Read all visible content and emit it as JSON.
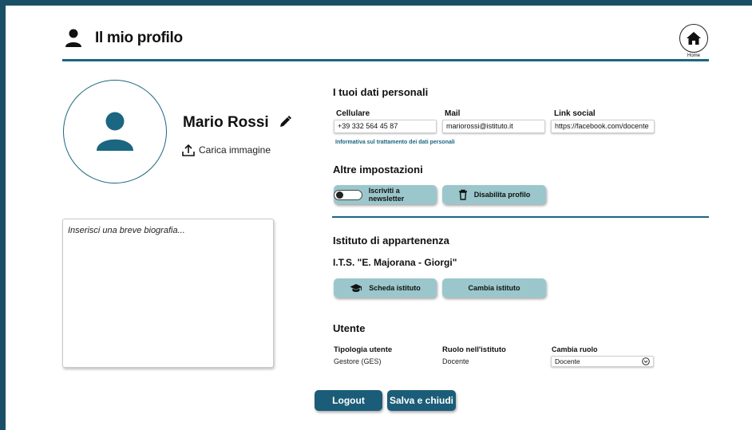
{
  "header": {
    "title": "Il mio profilo",
    "home_label": "Home"
  },
  "profile": {
    "name": "Mario Rossi",
    "upload_label": "Carica immagine",
    "bio_placeholder": "Inserisci una breve biografia..."
  },
  "personal": {
    "title": "I tuoi dati personali",
    "fields": [
      {
        "label": "Cellulare",
        "value": "+39 332 564 45 87"
      },
      {
        "label": "Mail",
        "value": "mariorossi@istituto.it"
      },
      {
        "label": "Link social",
        "value": "https://facebook.com/docente"
      }
    ],
    "privacy_link": "Informativa sul trattamento dei dati personali"
  },
  "settings": {
    "title": "Altre impostazioni",
    "newsletter_label": "Iscriviti a newsletter",
    "newsletter_on": false,
    "disable_label": "Disabilita profilo"
  },
  "institute": {
    "title": "Istituto di appartenenza",
    "name": "I.T.S. \"E. Majorana - Giorgi\"",
    "card_label": "Scheda istituto",
    "change_label": "Cambia istituto"
  },
  "user": {
    "title": "Utente",
    "type_label": "Tipologia utente",
    "type_value": "Gestore (GES)",
    "role_label": "Ruolo nell'istituto",
    "role_value": "Docente",
    "change_role_label": "Cambia ruolo",
    "change_role_value": "Docente"
  },
  "actions": {
    "logout": "Logout",
    "save_close": "Salva e chiudi"
  },
  "colors": {
    "frame": "#1b4f68",
    "accent": "#1b6680",
    "button_light": "#9bc7cc",
    "button_dark": "#1b5d78"
  }
}
